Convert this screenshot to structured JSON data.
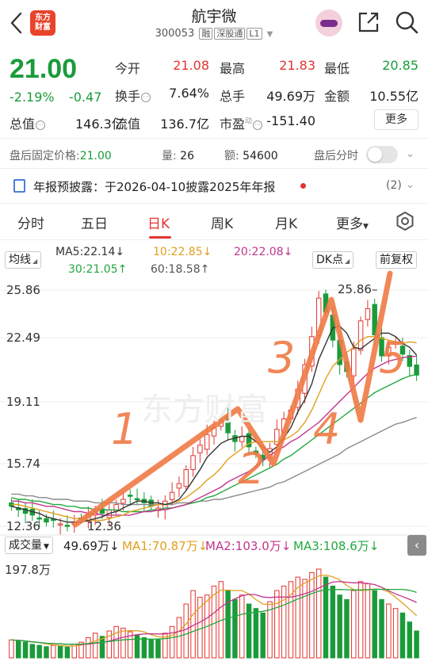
{
  "header": {
    "title": "航宇微",
    "code": "300053",
    "tags": [
      "融",
      "深股通",
      "L1"
    ],
    "logo_text_line1": "东方",
    "logo_text_line2": "财富"
  },
  "quote": {
    "price": "21.00",
    "change_pct": "-2.19%",
    "change_abs": "-0.47",
    "total_cap_label": "总值",
    "total_cap": "146.3亿",
    "float_cap_label": "流值",
    "float_cap": "136.7亿",
    "open_label": "今开",
    "open": "21.08",
    "high_label": "最高",
    "high": "21.83",
    "low_label": "最低",
    "low": "20.85",
    "turnover_label": "换手",
    "turnover": "7.64%",
    "volume_label": "总手",
    "volume": "49.69万",
    "amount_label": "金额",
    "amount": "10.55亿",
    "pe_label": "市盈",
    "pe_sup": "动",
    "pe": "-151.40",
    "more_label": "更多"
  },
  "after_hours": {
    "price_label": "盘后固定价格:",
    "price": "21.00",
    "qty_label": "量:",
    "qty": "26",
    "amount_label": "额:",
    "amount": "54600",
    "timeshare_label": "盘后分时"
  },
  "notice": {
    "text": "年报预披露：于2026-04-10披露2025年年报",
    "count": "(2)"
  },
  "tabs": [
    {
      "label": "分时"
    },
    {
      "label": "五日"
    },
    {
      "label": "日K"
    },
    {
      "label": "周K"
    },
    {
      "label": "月K"
    },
    {
      "label": "更多"
    }
  ],
  "ma": {
    "selector": "均线",
    "ma5": "MA5:22.14",
    "ma10": "10:22.85",
    "ma20": "20:22.08",
    "ma30": "30:21.05",
    "ma60": "60:18.58",
    "dk_label": "DK点",
    "adjust_label": "前复权"
  },
  "chart_data": {
    "type": "candlestick",
    "y_ticks": [
      "25.86",
      "22.49",
      "19.11",
      "15.74",
      "12.36"
    ],
    "ylim": [
      12.36,
      25.86
    ],
    "high_marker": "25.86",
    "low_marker": "12.36",
    "closes": [
      13.5,
      13.3,
      13.1,
      13.0,
      12.8,
      12.6,
      12.7,
      12.5,
      12.4,
      12.6,
      12.8,
      13.0,
      13.2,
      13.1,
      13.3,
      13.6,
      13.9,
      14.1,
      13.9,
      13.7,
      13.5,
      13.4,
      13.8,
      14.3,
      14.8,
      15.6,
      16.4,
      17.0,
      17.6,
      18.0,
      18.4,
      17.7,
      17.2,
      17.5,
      16.9,
      16.5,
      16.2,
      16.8,
      17.9,
      18.5,
      19.0,
      20.2,
      21.6,
      23.2,
      25.4,
      24.6,
      23.0,
      21.6,
      21.2,
      22.5,
      24.1,
      24.8,
      23.3,
      22.1,
      22.6,
      22.9,
      22.2,
      21.5,
      21.0
    ],
    "volumes_wan": [
      40,
      38,
      35,
      30,
      28,
      25,
      28,
      26,
      24,
      30,
      35,
      45,
      55,
      48,
      60,
      70,
      66,
      58,
      50,
      45,
      40,
      42,
      55,
      70,
      90,
      120,
      150,
      135,
      140,
      160,
      170,
      150,
      130,
      140,
      120,
      110,
      100,
      125,
      150,
      160,
      170,
      180,
      175,
      190,
      197.8,
      180,
      160,
      140,
      130,
      150,
      170,
      165,
      150,
      130,
      120,
      110,
      100,
      80,
      60
    ],
    "ma5": [
      13.5,
      13.4,
      13.3,
      13.2,
      13.1,
      12.9,
      12.8,
      12.7,
      12.6,
      12.6,
      12.6,
      12.7,
      12.8,
      12.9,
      13.1,
      13.2,
      13.4,
      13.6,
      13.8,
      13.8,
      13.7,
      13.7,
      13.6,
      13.7,
      13.9,
      14.4,
      15.0,
      15.6,
      16.3,
      16.7,
      17.1,
      17.3,
      17.4,
      17.5,
      17.5,
      17.2,
      16.9,
      16.6,
      16.9,
      17.4,
      18.0,
      18.9,
      19.6,
      20.5,
      21.9,
      22.8,
      23.7,
      23.8,
      23.4,
      22.6,
      22.5,
      22.8,
      23.1,
      23.4,
      23.4,
      23.2,
      22.8,
      22.6,
      22.14
    ],
    "ma10": [
      13.6,
      13.6,
      13.5,
      13.4,
      13.3,
      13.2,
      13.1,
      13.0,
      12.9,
      12.8,
      12.8,
      12.7,
      12.7,
      12.7,
      12.8,
      12.9,
      13.0,
      13.2,
      13.3,
      13.4,
      13.5,
      13.6,
      13.6,
      13.7,
      13.8,
      14.0,
      14.3,
      14.6,
      15.0,
      15.3,
      15.7,
      16.2,
      16.5,
      16.8,
      17.1,
      17.2,
      17.2,
      17.2,
      17.2,
      17.3,
      17.5,
      17.8,
      18.3,
      19.0,
      19.9,
      20.8,
      21.5,
      21.9,
      22.3,
      22.6,
      23.0,
      23.2,
      23.2,
      23.1,
      23.0,
      22.9,
      22.8,
      22.9,
      22.85
    ],
    "ma20": [
      13.8,
      13.8,
      13.7,
      13.7,
      13.6,
      13.5,
      13.5,
      13.4,
      13.3,
      13.2,
      13.2,
      13.1,
      13.1,
      13.0,
      13.0,
      13.0,
      13.0,
      13.0,
      13.1,
      13.2,
      13.2,
      13.3,
      13.3,
      13.4,
      13.5,
      13.6,
      13.8,
      14.0,
      14.2,
      14.4,
      14.6,
      14.9,
      15.1,
      15.3,
      15.5,
      15.8,
      16.1,
      16.4,
      16.7,
      16.9,
      17.2,
      17.4,
      17.7,
      18.0,
      18.3,
      18.7,
      19.1,
      19.5,
      19.9,
      20.3,
      20.7,
      21.1,
      21.4,
      21.6,
      21.8,
      21.9,
      22.0,
      22.05,
      22.08
    ],
    "ma30": [
      14.0,
      13.9,
      13.9,
      13.8,
      13.8,
      13.7,
      13.6,
      13.6,
      13.5,
      13.5,
      13.4,
      13.4,
      13.3,
      13.3,
      13.3,
      13.3,
      13.2,
      13.2,
      13.2,
      13.2,
      13.3,
      13.3,
      13.4,
      13.4,
      13.5,
      13.6,
      13.7,
      13.8,
      14.0,
      14.1,
      14.3,
      14.5,
      14.7,
      14.9,
      15.1,
      15.3,
      15.5,
      15.7,
      15.9,
      16.2,
      16.4,
      16.7,
      17.0,
      17.3,
      17.6,
      17.9,
      18.2,
      18.5,
      18.8,
      19.1,
      19.4,
      19.7,
      20.0,
      20.2,
      20.4,
      20.6,
      20.8,
      20.95,
      21.05
    ],
    "ma60": [
      14.2,
      14.2,
      14.1,
      14.1,
      14.0,
      14.0,
      13.9,
      13.9,
      13.9,
      13.8,
      13.8,
      13.8,
      13.7,
      13.7,
      13.7,
      13.7,
      13.6,
      13.6,
      13.6,
      13.6,
      13.6,
      13.6,
      13.6,
      13.6,
      13.7,
      13.7,
      13.7,
      13.8,
      13.8,
      13.9,
      13.9,
      14.0,
      14.1,
      14.2,
      14.3,
      14.4,
      14.5,
      14.6,
      14.8,
      14.9,
      15.1,
      15.3,
      15.5,
      15.7,
      15.9,
      16.1,
      16.3,
      16.5,
      16.8,
      17.0,
      17.2,
      17.4,
      17.6,
      17.8,
      18.0,
      18.2,
      18.3,
      18.45,
      18.58
    ]
  },
  "volume_panel": {
    "selector": "成交量",
    "vol": "49.69万",
    "ma1": "MA1:70.87万",
    "ma2": "MA2:103.0万",
    "ma3": "MA3:108.6万",
    "max_label": "197.8万",
    "collapse_symbol": "‹"
  },
  "colors": {
    "up": "#e3342f",
    "down": "#1a9b3a",
    "ma5": "#333333",
    "ma10": "#e0a01e",
    "ma20": "#c2358e",
    "ma30": "#21a83f",
    "ma60": "#8a8a8a",
    "annotation": "#f07a45"
  }
}
